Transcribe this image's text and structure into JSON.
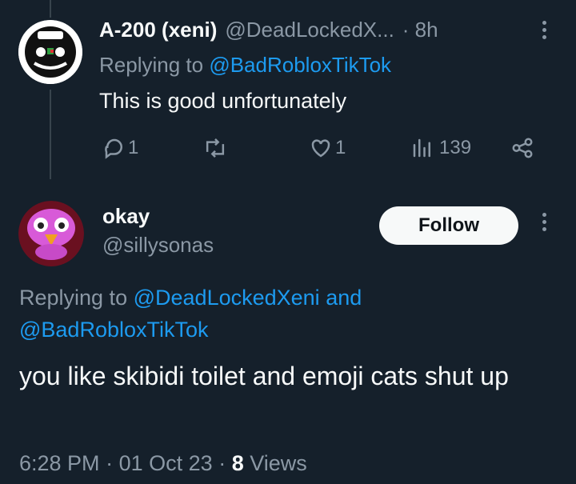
{
  "reply_tweet": {
    "display_name": "A-200 (xeni)",
    "handle": "@DeadLockedX...",
    "time": "· 8h",
    "replying_prefix": "Replying to",
    "replying_to": "@BadRobloxTikTok",
    "text": "This is good unfortunately",
    "stats": {
      "replies": "1",
      "reposts": "",
      "likes": "1",
      "views": "139"
    }
  },
  "main_tweet": {
    "display_name": "okay",
    "handle": "@sillysonas",
    "follow_label": "Follow",
    "replying_prefix": "Replying to",
    "replying_to_1": "@DeadLockedXeni",
    "replying_and": "and",
    "replying_to_2": "@BadRobloxTikTok",
    "text": "you like skibidi toilet and emoji cats shut up",
    "meta": {
      "time": "6:28 PM",
      "sep1": "·",
      "date": "01 Oct 23",
      "sep2": "·",
      "views_count": "8",
      "views_label": "Views"
    }
  },
  "colors": {
    "background": "#15202b",
    "text": "#f7f9f9",
    "muted": "#8b98a5",
    "link": "#1d9bf0"
  }
}
